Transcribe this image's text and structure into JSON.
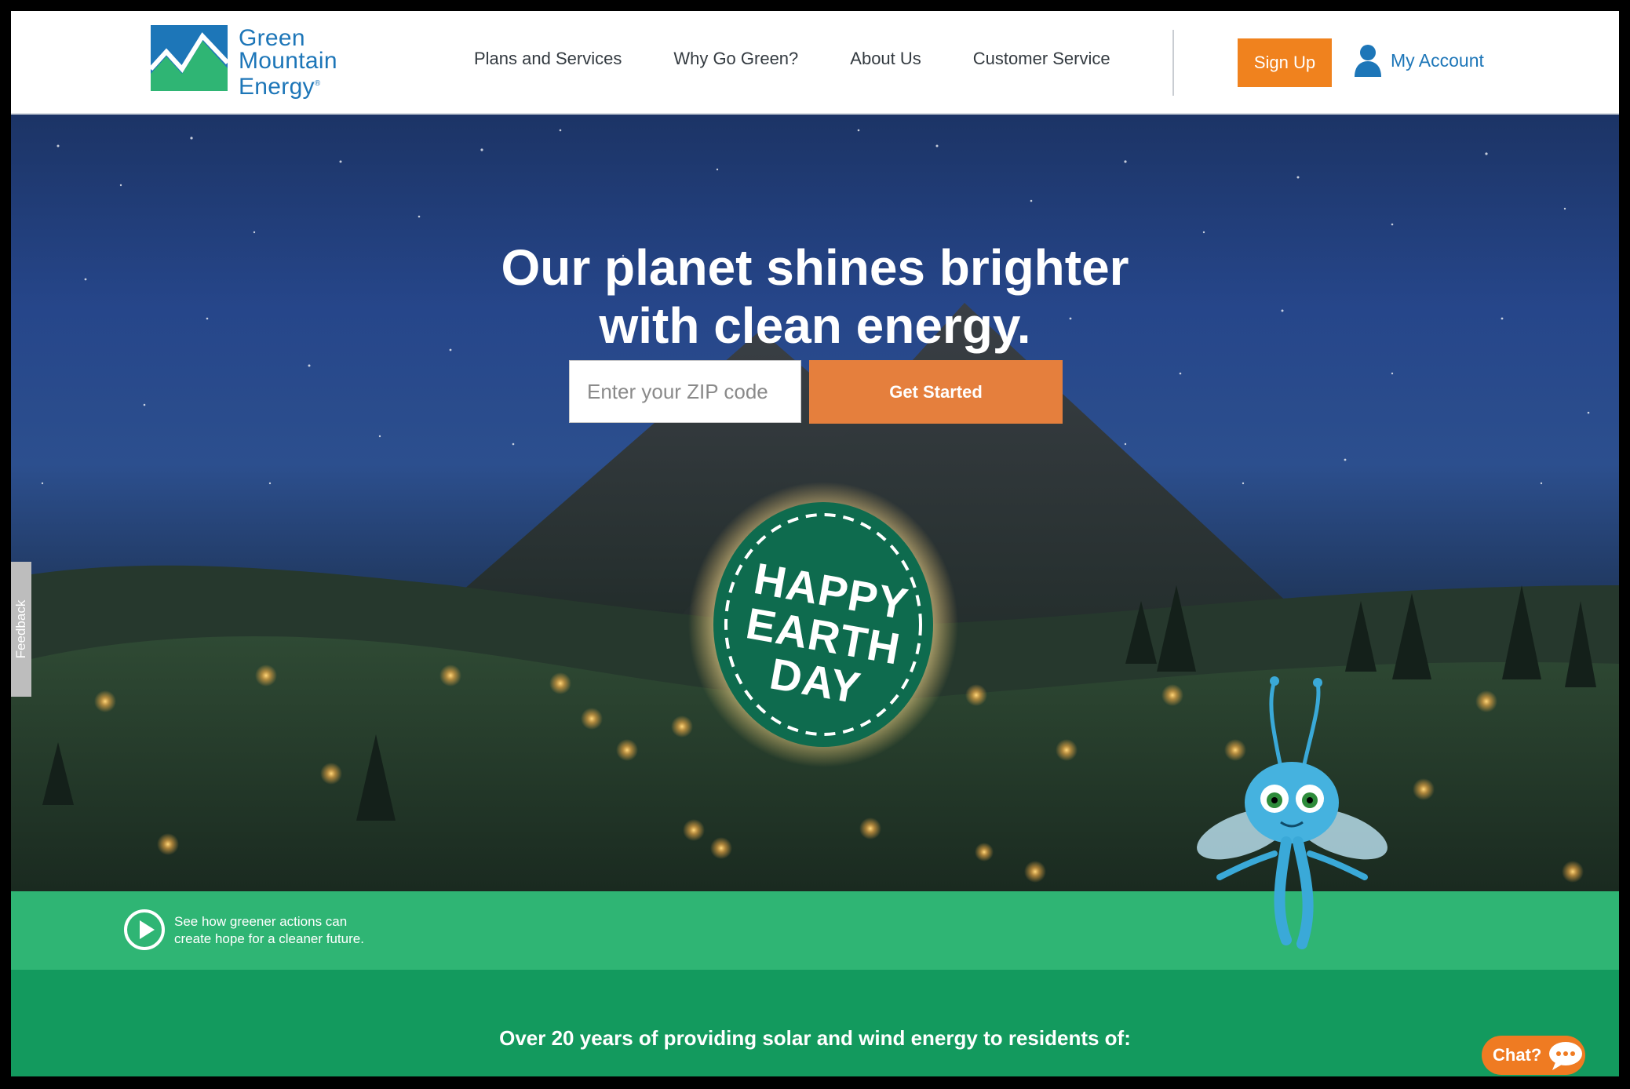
{
  "brand": {
    "name_lines": [
      "Green",
      "Mountain",
      "Energy"
    ],
    "registered": "®",
    "colors": {
      "blue": "#1d76b8",
      "green": "#2fb574",
      "dark_green": "#139a5e",
      "orange": "#f0821e"
    }
  },
  "nav": {
    "items": [
      {
        "label": "Plans and Services"
      },
      {
        "label": "Why Go Green?"
      },
      {
        "label": "About Us"
      },
      {
        "label": "Customer Service"
      }
    ],
    "sign_up": "Sign Up",
    "account": "My Account",
    "account_icon": "user-icon"
  },
  "hero": {
    "headline_lines": [
      "Our planet shines brighter",
      "with clean energy."
    ],
    "zip_placeholder": "Enter your ZIP code",
    "zip_value": "",
    "cta": "Get Started",
    "badge_lines": [
      "HAPPY",
      "EARTH",
      "DAY"
    ]
  },
  "feedback": {
    "label": "Feedback"
  },
  "video": {
    "lines": [
      "See how greener actions can",
      "create hope for a cleaner future."
    ],
    "icon": "play-icon"
  },
  "states": {
    "heading": "Over 20 years of providing solar and wind energy to residents of:"
  },
  "chat": {
    "label": "Chat?",
    "icon": "chat-bubble-icon"
  }
}
